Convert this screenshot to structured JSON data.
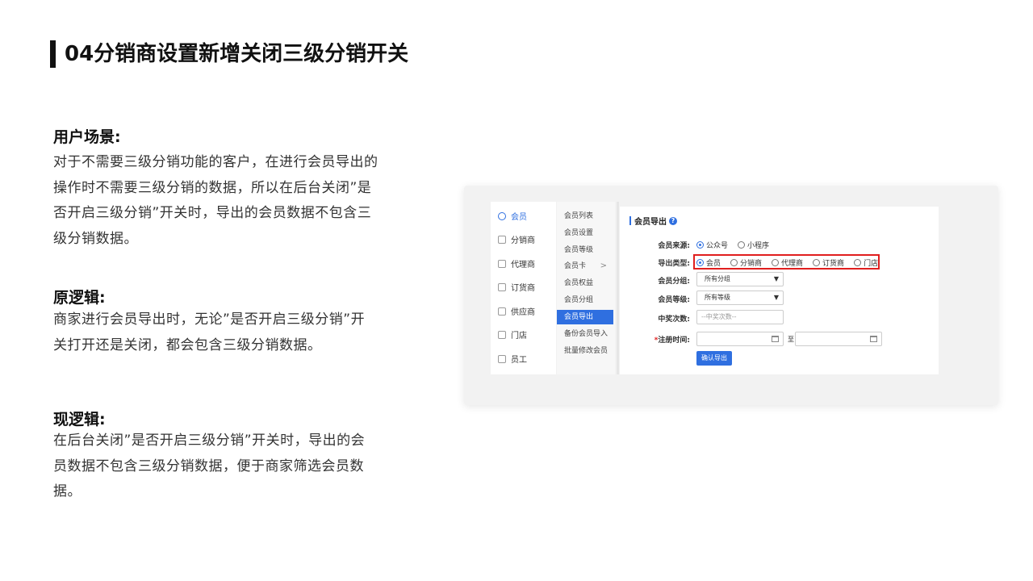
{
  "page": {
    "title": "04分销商设置新增关闭三级分销开关"
  },
  "sections": [
    {
      "heading": "用户场景:",
      "lines": [
        "对于不需要三级分销功能的客户，在进行会员导出的",
        "操作时不需要三级分销的数据，所以在后台关闭”是",
        "否开启三级分销”开关时，导出的会员数据不包含三",
        "级分销数据。"
      ]
    },
    {
      "heading": "原逻辑:",
      "lines": [
        "商家进行会员导出时，无论”是否开启三级分销”开",
        "关打开还是关闭，都会包含三级分销数据。"
      ]
    },
    {
      "heading": "现逻辑:",
      "lines": [
        "在后台关闭”是否开启三级分销”开关时，导出的会",
        "员数据不包含三级分销数据，便于商家筛选会员数",
        "据。"
      ]
    }
  ],
  "screenshot": {
    "sidebar": [
      "会员",
      "分销商",
      "代理商",
      "订货商",
      "供应商",
      "门店",
      "员工"
    ],
    "submenu": [
      "会员列表",
      "会员设置",
      "会员等级",
      "会员卡",
      "会员权益",
      "会员分组",
      "会员导出",
      "备份会员导入",
      "批量修改会员"
    ],
    "submenu_arrow": ">",
    "panel_title": "会员导出",
    "help_icon": "?",
    "form": {
      "source_label": "会员来源:",
      "source_options": [
        "公众号",
        "小程序"
      ],
      "type_label": "导出类型:",
      "type_options": [
        "会员",
        "分销商",
        "代理商",
        "订货商",
        "门店"
      ],
      "group_label": "会员分组:",
      "group_value": "所有分组",
      "level_label": "会员等级:",
      "level_value": "所有等级",
      "prize_label": "中奖次数:",
      "prize_placeholder": "--中奖次数--",
      "reg_label": "注册时间:",
      "reg_required": "*",
      "range_sep": "至",
      "submit": "确认导出"
    }
  }
}
